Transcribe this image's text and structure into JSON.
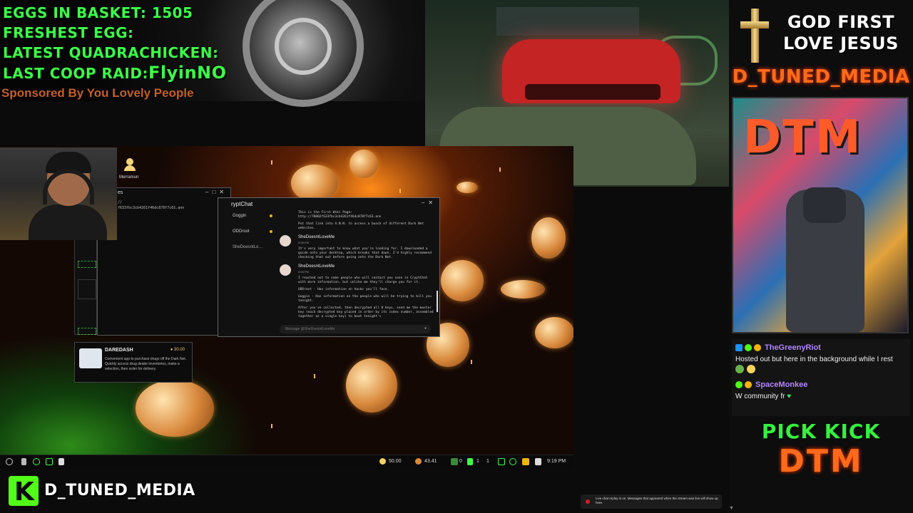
{
  "stats": {
    "eggs_label": "EGGS IN BASKET:",
    "eggs_value": "1505",
    "freshest_label": "FRESHEST EGG:",
    "quadrachicken_label": "LATEST QUADRACHICKEN:",
    "coop_raid_label": "LAST COOP RAID:",
    "coop_raid_name": "FlyinNO",
    "sponsor": "Sponsored By You Lovely People"
  },
  "right_panel": {
    "line1": "GOD FIRST",
    "line2": "LOVE JESUS",
    "brand": "D_TUNED_MEDIA",
    "cam_sign": "DTM",
    "pick_kick": "PICK KICK",
    "dtm": "DTM"
  },
  "chat": [
    {
      "user": "TheGreenyRiot",
      "color": "#b083ff",
      "text": "Hosted out but here in the background while I rest"
    },
    {
      "user": "SpaceMonkee",
      "color": "#b083ff",
      "text": "W community fr"
    }
  ],
  "game": {
    "desktop_user": "Merramun",
    "back_window": {
      "title": "es",
      "url_line1": "//",
      "url_line2": "f633fbc3cb4261f46dc878f7c61.ann"
    },
    "crypt_chat": {
      "title": "ryptChat",
      "contacts": [
        {
          "name": "Goggin",
          "dot": true
        },
        {
          "name": "ODDroot",
          "dot": true
        },
        {
          "name": "SheDoesntLo…",
          "dot": false
        }
      ],
      "message_intro_1": "This is the First Wiki Page:",
      "message_intro_2": "http://78002f633fbc3cb4261f46dc878f7c61.ann",
      "message_intro_3": "Put that link into A.N.N. to access a bunch of different Dark Net websites.",
      "sender1": "SheDoesntLoveMe",
      "time1": "9:08 PM",
      "message1": "It's very important to know what you're looking for. I downloaded a guide onto your desktop, which breaks that down. I'd highly recommend checking that out before going onto the Dark Net.",
      "sender2": "SheDoesntLoveMe",
      "time2": "9:08 PM",
      "message2a": "I reached out to some people who will contact you soon in CryptChat with more information, but unlike me they'll charge you for it.",
      "message2b": "ODDroot - Has information on hacks you'll face.",
      "message2c": "Goggin - Has information on the people who will be trying to kill you tonight.",
      "message2d": "After you've collected, then decrypted all 8 keys, send me the master key (each decrypted key placed in order by its index number, assembled together as a single key) to beat tonight's",
      "input_placeholder": "Message @SheDoesntLoveMe"
    },
    "daredash": {
      "title": "DAREDASH",
      "price": "30.00",
      "description": "Convenient app to purchase drugs off the Dark Net. Quickly access drug dealer inventories, make a selection, then order for delivery."
    },
    "taskbar": {
      "balance1": "50.00",
      "balance2": "43.41",
      "counter1": "0",
      "counter2": "1",
      "counter3": "1",
      "clock": "9:19 PM"
    }
  },
  "bottom_brand": "D_TUNED_MEDIA",
  "kick_letter": "K",
  "replay_notice": "Live chat replay is on. Messages that appeared when the stream was live will show up here.",
  "colors": {
    "stat_green": "#3cff4a",
    "brand_orange": "#ff6a1a",
    "kick_green": "#53fc18"
  }
}
